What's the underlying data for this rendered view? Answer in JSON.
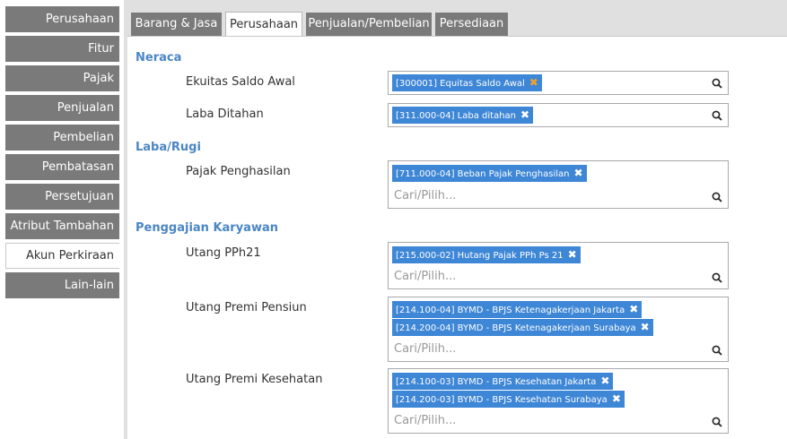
{
  "sidebar": {
    "items": [
      {
        "label": "Perusahaan",
        "active": false
      },
      {
        "label": "Fitur",
        "active": false
      },
      {
        "label": "Pajak",
        "active": false
      },
      {
        "label": "Penjualan",
        "active": false
      },
      {
        "label": "Pembelian",
        "active": false
      },
      {
        "label": "Pembatasan",
        "active": false
      },
      {
        "label": "Persetujuan",
        "active": false
      },
      {
        "label": "Atribut Tambahan",
        "active": false
      },
      {
        "label": "Akun Perkiraan",
        "active": true
      },
      {
        "label": "Lain-lain",
        "active": false
      }
    ]
  },
  "tabs": [
    {
      "label": "Barang & Jasa",
      "active": false
    },
    {
      "label": "Perusahaan",
      "active": true
    },
    {
      "label": "Penjualan/Pembelian",
      "active": false
    },
    {
      "label": "Persediaan",
      "active": false
    }
  ],
  "sections": {
    "neraca": {
      "title": "Neraca",
      "ekuitas": {
        "label": "Ekuitas Saldo Awal",
        "chips": [
          "[300001] Equitas Saldo Awal"
        ]
      },
      "laba_ditahan": {
        "label": "Laba Ditahan",
        "chips": [
          "[311.000-04] Laba ditahan"
        ]
      }
    },
    "laba_rugi": {
      "title": "Laba/Rugi",
      "pajak_penghasilan": {
        "label": "Pajak Penghasilan",
        "chips": [
          "[711.000-04] Beban Pajak Penghasilan"
        ],
        "placeholder": "Cari/Pilih..."
      }
    },
    "penggajian": {
      "title": "Penggajian Karyawan",
      "utang_pph21": {
        "label": "Utang PPh21",
        "chips": [
          "[215.000-02] Hutang Pajak PPh Ps 21"
        ],
        "placeholder": "Cari/Pilih..."
      },
      "utang_premi_pensiun": {
        "label": "Utang Premi Pensiun",
        "chips": [
          "[214.100-04] BYMD - BPJS Ketenagakerjaan Jakarta",
          "[214.200-04] BYMD - BPJS Ketenagakerjaan Surabaya"
        ],
        "placeholder": "Cari/Pilih..."
      },
      "utang_premi_kesehatan": {
        "label": "Utang Premi Kesehatan",
        "chips": [
          "[214.100-03] BYMD - BPJS Kesehatan Jakarta",
          "[214.200-03] BYMD - BPJS Kesehatan Surabaya"
        ],
        "placeholder": "Cari/Pilih..."
      }
    }
  },
  "icons": {
    "remove": "close-icon",
    "search": "search-icon"
  },
  "colors": {
    "accent": "#4a86c5",
    "chip": "#3e86d6",
    "sidebar": "#7a7a7a",
    "remove_highlight": "#f0a030"
  }
}
